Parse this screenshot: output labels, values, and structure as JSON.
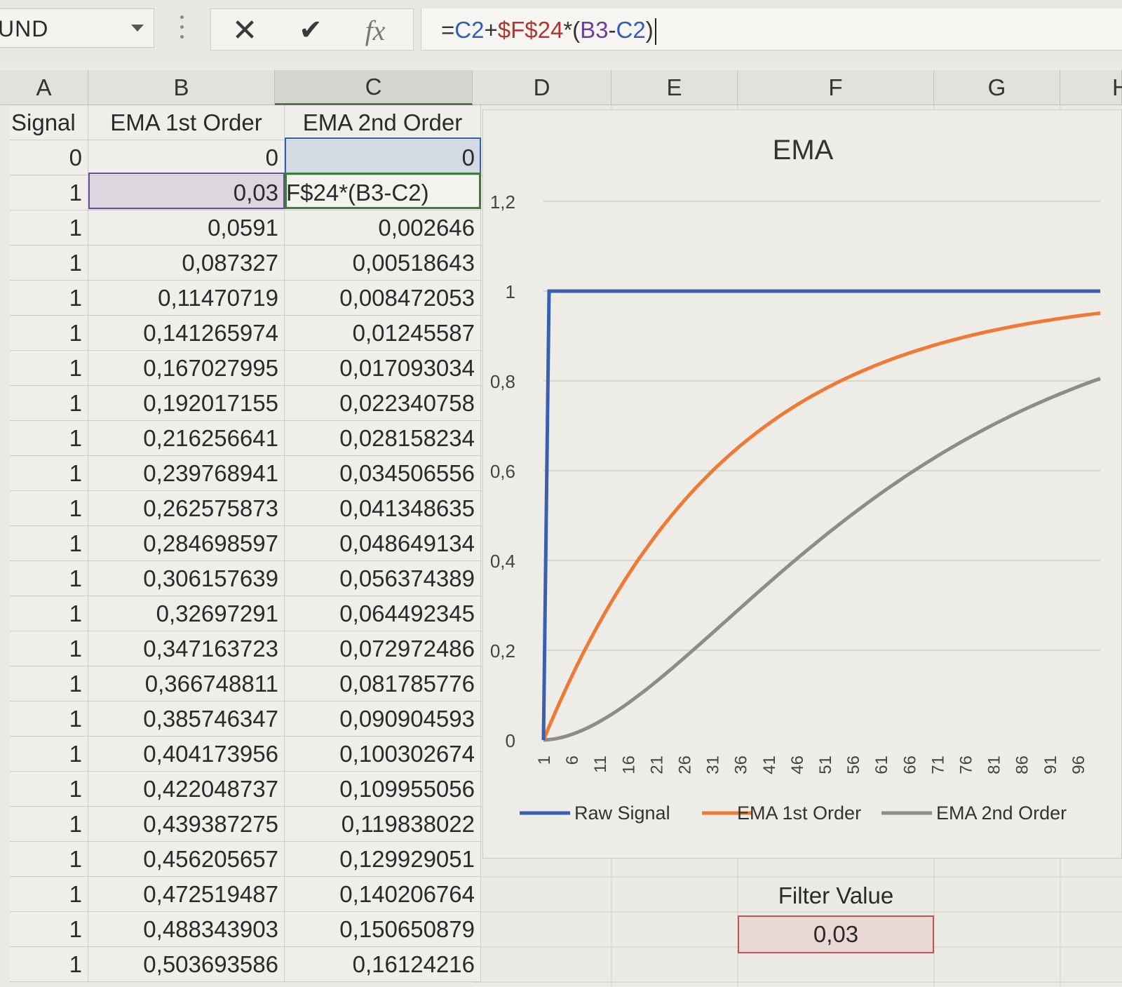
{
  "name_box": {
    "value": "UND"
  },
  "formula_bar": {
    "cancel_label": "✕",
    "enter_label": "✔",
    "fx_label": "fx",
    "parts": [
      "=",
      "C2",
      "+",
      "$F$24",
      "*(",
      "B3",
      "-",
      "C2",
      ")"
    ]
  },
  "columns": [
    "A",
    "B",
    "C",
    "D",
    "E",
    "F",
    "G",
    "H"
  ],
  "table": {
    "headers": [
      "Signal",
      "EMA 1st Order",
      "EMA 2nd Order"
    ],
    "editing_text": "F$24*(B3-C2)",
    "rows": [
      [
        "0",
        "0",
        "0"
      ],
      [
        "1",
        "0,03",
        ""
      ],
      [
        "1",
        "0,0591",
        "0,002646"
      ],
      [
        "1",
        "0,087327",
        "0,00518643"
      ],
      [
        "1",
        "0,11470719",
        "0,008472053"
      ],
      [
        "1",
        "0,141265974",
        "0,01245587"
      ],
      [
        "1",
        "0,167027995",
        "0,017093034"
      ],
      [
        "1",
        "0,192017155",
        "0,022340758"
      ],
      [
        "1",
        "0,216256641",
        "0,028158234"
      ],
      [
        "1",
        "0,239768941",
        "0,034506556"
      ],
      [
        "1",
        "0,262575873",
        "0,041348635"
      ],
      [
        "1",
        "0,284698597",
        "0,048649134"
      ],
      [
        "1",
        "0,306157639",
        "0,056374389"
      ],
      [
        "1",
        "0,32697291",
        "0,064492345"
      ],
      [
        "1",
        "0,347163723",
        "0,072972486"
      ],
      [
        "1",
        "0,366748811",
        "0,081785776"
      ],
      [
        "1",
        "0,385746347",
        "0,090904593"
      ],
      [
        "1",
        "0,404173956",
        "0,100302674"
      ],
      [
        "1",
        "0,422048737",
        "0,109955056"
      ],
      [
        "1",
        "0,439387275",
        "0,119838022"
      ],
      [
        "1",
        "0,456205657",
        "0,129929051"
      ],
      [
        "1",
        "0,472519487",
        "0,140206764"
      ],
      [
        "1",
        "0,488343903",
        "0,150650879"
      ],
      [
        "1",
        "0,503693586",
        "0,16124216"
      ]
    ]
  },
  "filter": {
    "label": "Filter Value",
    "value": "0,03"
  },
  "colors": {
    "raw_signal": "#3a5fb0",
    "ema1": "#ee7a35",
    "ema2": "#8c8c8c",
    "formula_ref_c": "#2f5fb8",
    "formula_ref_f": "#b0372f",
    "formula_ref_b": "#6b3e9c"
  },
  "chart_data": {
    "type": "line",
    "title": "EMA",
    "ylim": [
      0,
      1.2
    ],
    "yticks": [
      "0",
      "0,2",
      "0,4",
      "0,6",
      "0,8",
      "1",
      "1,2"
    ],
    "x_tick_labels": [
      "1",
      "6",
      "11",
      "16",
      "21",
      "26",
      "31",
      "36",
      "41",
      "46",
      "51",
      "56",
      "61",
      "66",
      "71",
      "76",
      "81",
      "86",
      "91",
      "96"
    ],
    "x_count": 100,
    "filter_value": 0.03,
    "grid": true,
    "legend": "bottom",
    "series": [
      {
        "name": "Raw Signal",
        "rule": "0 at x=1, then 1"
      },
      {
        "name": "EMA 1st Order",
        "rule": "y[n] = y[n-1] + 0.03*(signal[n] - y[n-1])"
      },
      {
        "name": "EMA 2nd Order",
        "rule": "z[n] = z[n-1] + 0.03*(EMA1[n] - z[n-1])"
      }
    ]
  }
}
